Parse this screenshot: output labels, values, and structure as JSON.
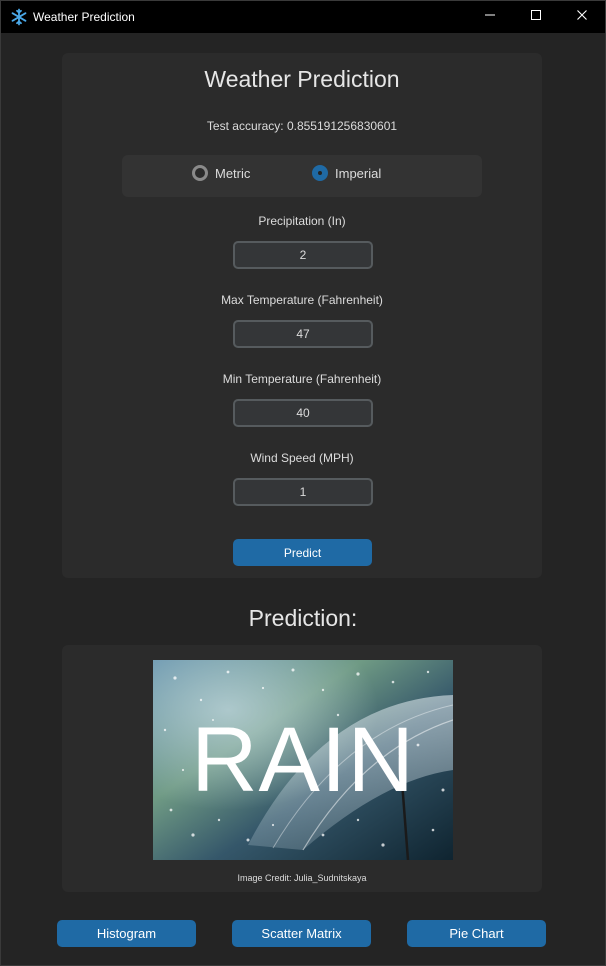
{
  "window": {
    "title": "Weather Prediction"
  },
  "form": {
    "heading": "Weather Prediction",
    "accuracy": "Test accuracy: 0.855191256830601",
    "units": {
      "options": [
        "Metric",
        "Imperial"
      ],
      "selected": "Imperial"
    },
    "fields": [
      {
        "label": "Precipitation (In)",
        "value": "2"
      },
      {
        "label": "Max Temperature (Fahrenheit)",
        "value": "47"
      },
      {
        "label": "Min Temperature (Fahrenheit)",
        "value": "40"
      },
      {
        "label": "Wind Speed (MPH)",
        "value": "1"
      }
    ],
    "predict_label": "Predict"
  },
  "result": {
    "heading": "Prediction:",
    "prediction": "RAIN",
    "credit": "Image Credit: Julia_Sudnitskaya"
  },
  "buttons": {
    "histogram": "Histogram",
    "scatter": "Scatter Matrix",
    "pie": "Pie Chart"
  },
  "colors": {
    "accent": "#1f6aa5",
    "background": "#242424",
    "card": "#2b2b2b"
  },
  "icons": {
    "app": "snowflake-icon",
    "minimize": "minimize-icon",
    "maximize": "maximize-icon",
    "close": "close-icon",
    "image": "umbrella-rain-photo"
  }
}
